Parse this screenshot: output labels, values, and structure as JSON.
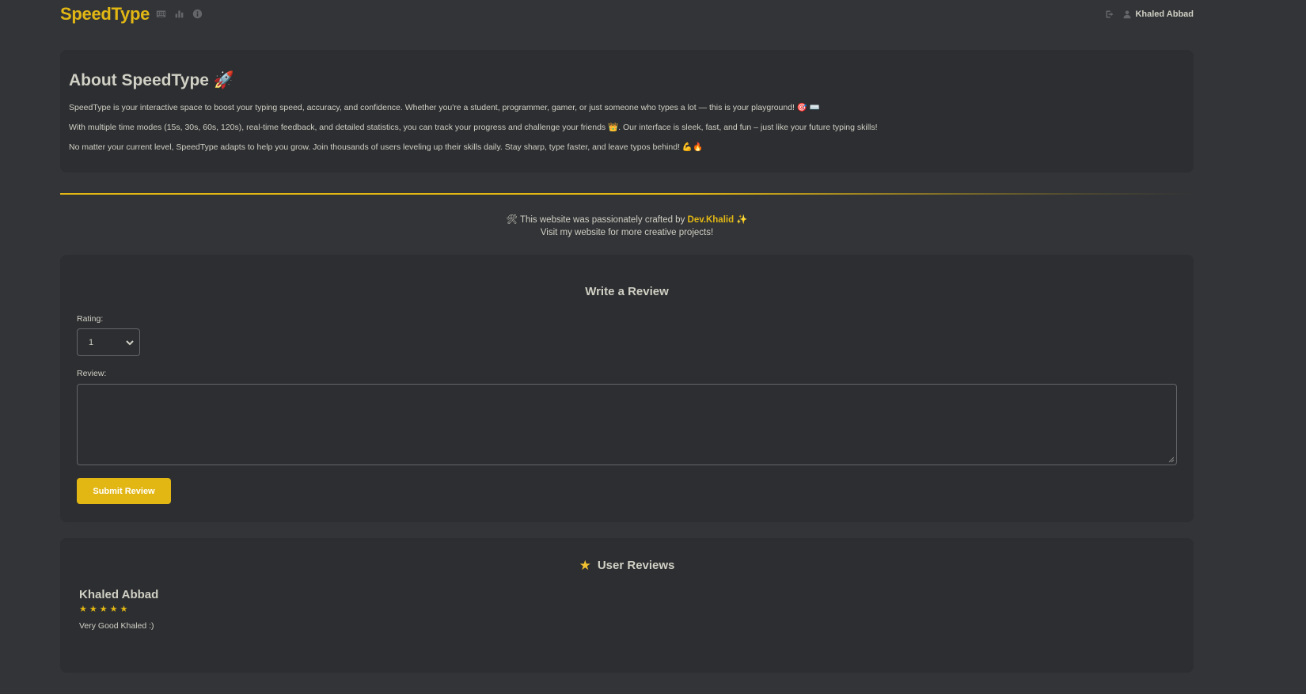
{
  "header": {
    "logo": "SpeedType",
    "nav_icons": [
      "keyboard-icon",
      "stats-icon",
      "info-icon"
    ],
    "logout_icon": "logout-icon",
    "user_icon": "user-icon",
    "username": "Khaled Abbad"
  },
  "about": {
    "title": "About SpeedType 🚀",
    "paragraphs": [
      "SpeedType is your interactive space to boost your typing speed, accuracy, and confidence. Whether you're a student, programmer, gamer, or just someone who types a lot — this is your playground! 🎯 ⌨️",
      "With multiple time modes (15s, 30s, 60s, 120s), real-time feedback, and detailed statistics, you can track your progress and challenge your friends 👑. Our interface is sleek, fast, and fun – just like your future typing skills!",
      "No matter your current level, SpeedType adapts to help you grow. Join thousands of users leveling up their skills daily. Stay sharp, type faster, and leave typos behind! 💪🔥"
    ]
  },
  "credit": {
    "prefix": "🛠 This website was passionately crafted by ",
    "author": "Dev.Khalid",
    "suffix": " ✨",
    "line2": "Visit my website for more creative projects!"
  },
  "review_form": {
    "title": "Write a Review",
    "rating_label": "Rating:",
    "rating_value": "1",
    "review_label": "Review:",
    "review_value": "",
    "submit_label": "Submit Review"
  },
  "user_reviews": {
    "title": "User Reviews",
    "title_icon": "★",
    "items": [
      {
        "name": "Khaled Abbad",
        "stars": "★★★★★",
        "rating": 5,
        "text": "Very Good Khaled :)"
      }
    ]
  },
  "colors": {
    "accent": "#e2b714",
    "background": "#323437",
    "card": "#2c2e31",
    "text": "#d1d0c5",
    "muted": "#646669"
  }
}
